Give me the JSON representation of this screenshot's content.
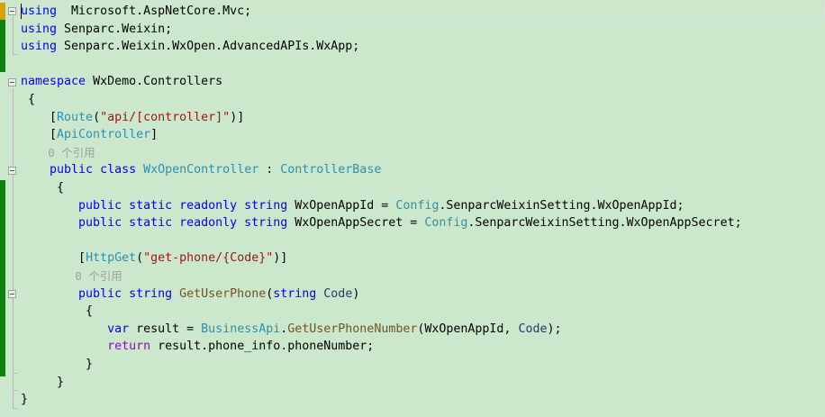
{
  "colors": {
    "background": "#cce8cc",
    "keyword": "#0000ff",
    "type": "#2b91af",
    "string": "#a31515",
    "method": "#74531f",
    "control": "#8f08c4",
    "parameter": "#1f377f",
    "codelens": "#a0a0a0",
    "change_saved": "#108010",
    "change_unsaved": "#d8a000"
  },
  "editor": {
    "lines": [
      {
        "tokens": [
          [
            "kw",
            "using"
          ],
          [
            "",
            "  Microsoft.AspNetCore.Mvc;"
          ]
        ]
      },
      {
        "tokens": [
          [
            "kw",
            "using"
          ],
          [
            "",
            " Senparc.Weixin;"
          ]
        ]
      },
      {
        "tokens": [
          [
            "kw",
            "using"
          ],
          [
            "",
            " Senparc.Weixin.WxOpen.AdvancedAPIs.WxApp;"
          ]
        ]
      },
      {
        "tokens": []
      },
      {
        "tokens": [
          [
            "kw",
            "namespace"
          ],
          [
            "",
            " WxDemo.Controllers"
          ]
        ]
      },
      {
        "tokens": [
          [
            "",
            " {"
          ]
        ]
      },
      {
        "tokens": [
          [
            "",
            "    ["
          ],
          [
            "ty",
            "Route"
          ],
          [
            "",
            "("
          ],
          [
            "str",
            "\"api/[controller]\""
          ],
          [
            "",
            ")]"
          ]
        ]
      },
      {
        "tokens": [
          [
            "",
            "    ["
          ],
          [
            "ty",
            "ApiController"
          ],
          [
            "",
            "]"
          ]
        ]
      },
      {
        "tokens": [
          [
            "lens",
            "    0 个引用"
          ]
        ]
      },
      {
        "tokens": [
          [
            "",
            "    "
          ],
          [
            "kw",
            "public class"
          ],
          [
            "",
            " "
          ],
          [
            "ty",
            "WxOpenController"
          ],
          [
            "",
            " : "
          ],
          [
            "ty",
            "ControllerBase"
          ]
        ]
      },
      {
        "tokens": [
          [
            "",
            "     {"
          ]
        ]
      },
      {
        "tokens": [
          [
            "",
            "        "
          ],
          [
            "kw",
            "public static readonly string"
          ],
          [
            "",
            " WxOpenAppId = "
          ],
          [
            "ty",
            "Config"
          ],
          [
            "",
            ".SenparcWeixinSetting.WxOpenAppId;"
          ]
        ]
      },
      {
        "tokens": [
          [
            "",
            "        "
          ],
          [
            "kw",
            "public static readonly string"
          ],
          [
            "",
            " WxOpenAppSecret = "
          ],
          [
            "ty",
            "Config"
          ],
          [
            "",
            ".SenparcWeixinSetting.WxOpenAppSecret;"
          ]
        ]
      },
      {
        "tokens": []
      },
      {
        "tokens": [
          [
            "",
            "        ["
          ],
          [
            "ty",
            "HttpGet"
          ],
          [
            "",
            "("
          ],
          [
            "str",
            "\"get-phone/{Code}\""
          ],
          [
            "",
            ")]"
          ]
        ]
      },
      {
        "tokens": [
          [
            "lens",
            "        0 个引用"
          ]
        ]
      },
      {
        "tokens": [
          [
            "",
            "        "
          ],
          [
            "kw",
            "public string"
          ],
          [
            "",
            " "
          ],
          [
            "me",
            "GetUserPhone"
          ],
          [
            "",
            "("
          ],
          [
            "kw",
            "string"
          ],
          [
            "",
            " "
          ],
          [
            "pa",
            "Code"
          ],
          [
            "",
            ")"
          ]
        ]
      },
      {
        "tokens": [
          [
            "",
            "         {"
          ]
        ]
      },
      {
        "tokens": [
          [
            "",
            "            "
          ],
          [
            "kw",
            "var"
          ],
          [
            "",
            " result = "
          ],
          [
            "ty",
            "BusinessApi"
          ],
          [
            "",
            "."
          ],
          [
            "me",
            "GetUserPhoneNumber"
          ],
          [
            "",
            "(WxOpenAppId, "
          ],
          [
            "pa",
            "Code"
          ],
          [
            "",
            ");"
          ]
        ]
      },
      {
        "tokens": [
          [
            "",
            "            "
          ],
          [
            "ctl",
            "return"
          ],
          [
            "",
            " result.phone_info.phoneNumber;"
          ]
        ]
      },
      {
        "tokens": [
          [
            "",
            "         }"
          ]
        ]
      },
      {
        "tokens": [
          [
            "",
            "     }"
          ]
        ]
      },
      {
        "tokens": [
          [
            "",
            "}"
          ]
        ]
      }
    ]
  }
}
